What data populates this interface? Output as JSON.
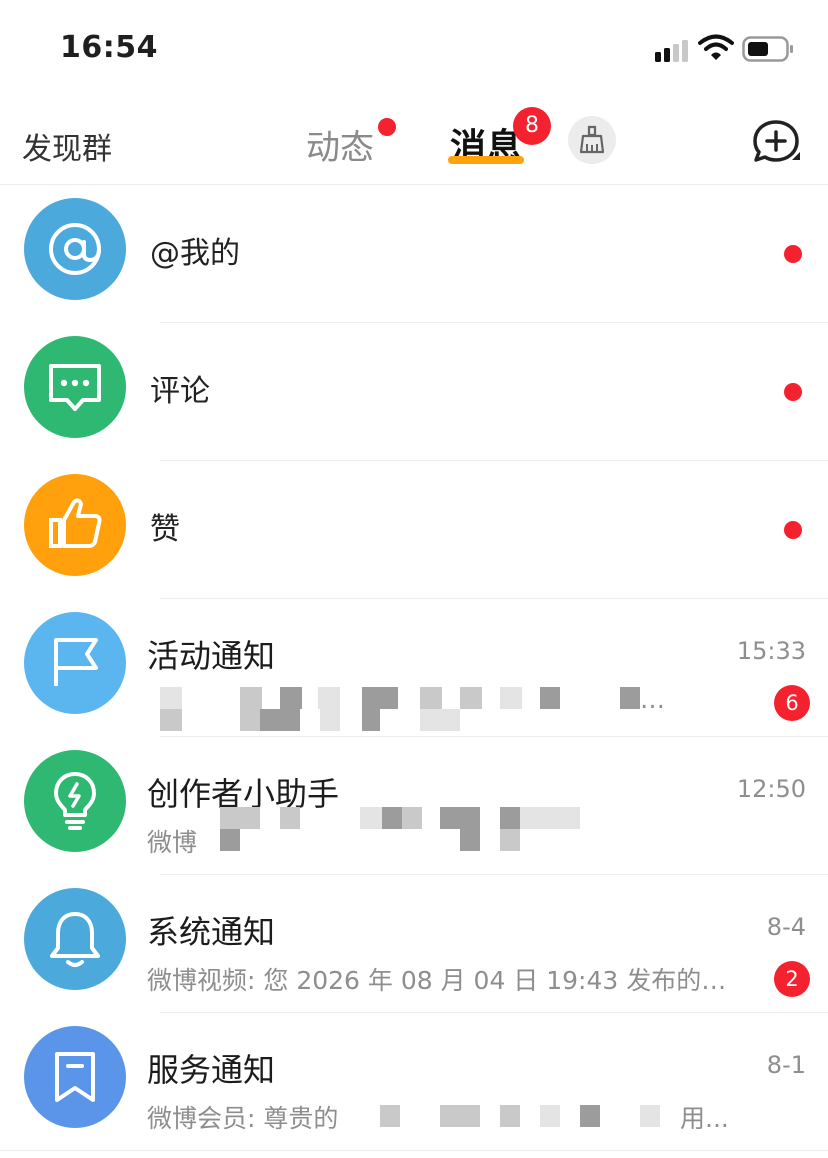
{
  "status_bar": {
    "time": "16:54",
    "signal_icon": "signal-icon",
    "wifi_icon": "wifi-icon",
    "battery_icon": "battery-icon"
  },
  "nav": {
    "discover_label": "发现群",
    "tabs": [
      {
        "label": "动态",
        "has_dot": true,
        "active": false
      },
      {
        "label": "消息",
        "badge": "8",
        "active": true
      }
    ],
    "clean_icon": "broom-icon",
    "add_icon": "add-chat-icon"
  },
  "colors": {
    "accent": "#ffa20b",
    "badge_red": "#f4212e",
    "text_gray": "#8e8e8e"
  },
  "messages": [
    {
      "label": "@我的",
      "icon": "at-icon",
      "color": "#4ca9dc",
      "unread_dot": true
    },
    {
      "label": "评论",
      "icon": "comment-icon",
      "color": "#2eb872",
      "unread_dot": true
    },
    {
      "label": "赞",
      "icon": "thumb-up-icon",
      "color": "#ffa00c",
      "unread_dot": true
    },
    {
      "title": "活动通知",
      "time": "15:33",
      "preview": "…",
      "count": "6",
      "icon": "flag-icon",
      "color": "#5bb6ef"
    },
    {
      "title": "创作者小助手",
      "time": "12:50",
      "preview": "微博",
      "icon": "lightbulb-icon",
      "color": "#2eb872"
    },
    {
      "title": "系统通知",
      "time": "8-4",
      "preview": "微博视频: 您 2026 年 08 月 04 日 19:43 发布的…",
      "count": "2",
      "icon": "bell-icon",
      "color": "#4ca9dc"
    },
    {
      "title": "服务通知",
      "time": "8-1",
      "preview": "微博会员: 尊贵的",
      "preview_tail": "用...",
      "icon": "bookmark-icon",
      "color": "#5b95ea"
    }
  ]
}
